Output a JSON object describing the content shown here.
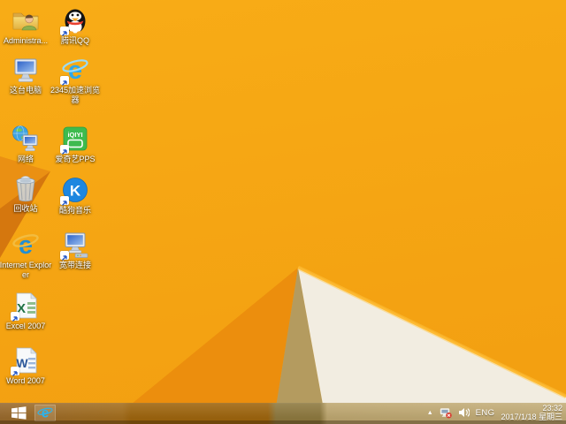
{
  "desktop": {
    "icons": [
      {
        "id": "admin-folder",
        "label": "Administra..."
      },
      {
        "id": "qq",
        "label": "腾讯QQ"
      },
      {
        "id": "this-pc",
        "label": "这台电脑"
      },
      {
        "id": "browser-2345",
        "label": "2345加速浏览器"
      },
      {
        "id": "network",
        "label": "网络"
      },
      {
        "id": "iqiyi-pps",
        "label": "爱奇艺PPS"
      },
      {
        "id": "recycle-bin",
        "label": "回收站"
      },
      {
        "id": "kugou",
        "label": "酷狗音乐"
      },
      {
        "id": "ie",
        "label": "Internet Explorer"
      },
      {
        "id": "broadband",
        "label": "宽带连接"
      },
      {
        "id": "excel",
        "label": "Excel 2007"
      },
      {
        "id": "word",
        "label": "Word 2007"
      }
    ]
  },
  "taskbar": {
    "tray": {
      "hidden_icons_glyph": "▲",
      "language": "ENG",
      "time": "23:32",
      "date": "2017/1/18 星期三"
    }
  },
  "colors": {
    "wallpaper_main": "#F6A714",
    "wallpaper_dark_facet": "#EC8E0D",
    "wallpaper_spike_light": "#EA9013",
    "wallpaper_spike_dark": "#D5770E",
    "wallpaper_tan": "#B49B5F",
    "wallpaper_white": "#F2EDE1",
    "edge_highlight": "#FFBB33",
    "taskbar_tint": "#9F660F"
  }
}
